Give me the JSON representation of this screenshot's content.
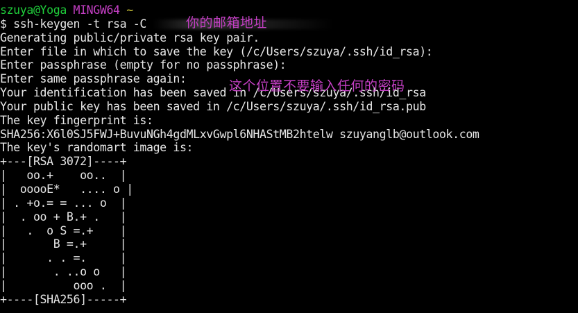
{
  "prompt": {
    "user_host": "szuya@Yoga",
    "shell": "MINGW64",
    "cwd": "~"
  },
  "command": "$ ssh-keygen -t rsa -C",
  "output_lines": [
    "Generating public/private rsa key pair.",
    "Enter file in which to save the key (/c/Users/szuya/.ssh/id_rsa):",
    "Enter passphrase (empty for no passphrase):",
    "Enter same passphrase again:",
    "Your identification has been saved in /c/Users/szuya/.ssh/id_rsa",
    "Your public key has been saved in /c/Users/szuya/.ssh/id_rsa.pub",
    "The key fingerprint is:",
    "SHA256:X6l0SJ5FWJ+BuvuNGh4gdMLxvGwpl6NHAStMB2htelw szuyanglb@outlook.com",
    "The key's randomart image is:",
    "+---[RSA 3072]----+",
    "|   oo.+    oo..  |",
    "|  ooooE*   .... o |",
    "| . +o.= = ... o  |",
    "|  . oo + B.+ .   |",
    "|   .  o S =.+    |",
    "|       B =.+     |",
    "|      . . =.     |",
    "|       . ..o o   |",
    "|          ooo .  |",
    "+----[SHA256]-----+"
  ],
  "annotations": {
    "email_hint": "你的邮箱地址",
    "passphrase_hint": "这个位置不要输入任何的密码"
  },
  "colors": {
    "background": "#000000",
    "text": "#e6e6e6",
    "user_host": "#1fcf3b",
    "shell": "#c43fc4",
    "cwd": "#d6cd3a",
    "annotation": "#c43fc4"
  }
}
